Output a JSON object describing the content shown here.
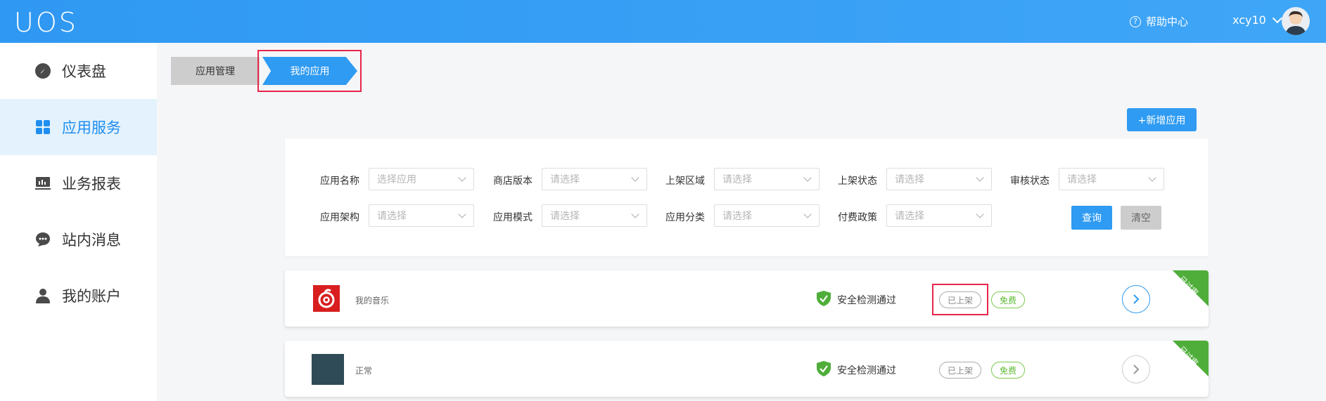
{
  "header": {
    "logo": "UOS",
    "help": "帮助中心",
    "username": "xcy10"
  },
  "sidebar": {
    "items": [
      {
        "label": "仪表盘",
        "icon": "dashboard-icon"
      },
      {
        "label": "应用服务",
        "icon": "grid-icon",
        "active": true
      },
      {
        "label": "业务报表",
        "icon": "monitor-icon"
      },
      {
        "label": "站内消息",
        "icon": "message-icon"
      },
      {
        "label": "我的账户",
        "icon": "user-icon"
      }
    ]
  },
  "breadcrumb": {
    "first": "应用管理",
    "second": "我的应用"
  },
  "add_button": "+新增应用",
  "filters": {
    "row1": [
      {
        "label": "应用名称",
        "placeholder": "选择应用"
      },
      {
        "label": "商店版本",
        "placeholder": "请选择"
      },
      {
        "label": "上架区域",
        "placeholder": "请选择"
      },
      {
        "label": "上架状态",
        "placeholder": "请选择"
      },
      {
        "label": "审核状态",
        "placeholder": "请选择"
      }
    ],
    "row2": [
      {
        "label": "应用架构",
        "placeholder": "请选择"
      },
      {
        "label": "应用模式",
        "placeholder": "请选择"
      },
      {
        "label": "应用分类",
        "placeholder": "请选择"
      },
      {
        "label": "付费政策",
        "placeholder": "请选择"
      }
    ],
    "query": "查询",
    "clear": "清空"
  },
  "apps": [
    {
      "name": "我的音乐",
      "security": "安全检测通过",
      "shelf": "已上架",
      "price": "免费",
      "corner": "已过审"
    },
    {
      "name": "正常",
      "security": "安全检测通过",
      "shelf": "已上架",
      "price": "免费",
      "corner": "已过审"
    }
  ],
  "colors": {
    "primary": "#2f9bf2",
    "highlight": "#e8254a",
    "success": "#4fae3a"
  }
}
